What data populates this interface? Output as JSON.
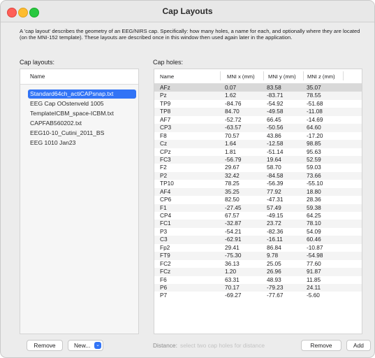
{
  "window": {
    "title": "Cap Layouts",
    "description": "A 'cap layout' describes the geometry of an EEG/NIRS cap. Specifically: how many holes, a name for each, and optionally where they are located (on the MNI-152 template). These layouts are described once in this window then used again later in the application."
  },
  "cap_layouts": {
    "label": "Cap layouts:",
    "column_header": "Name",
    "items": [
      {
        "label": "Standard64ch_actiCAPsnap.txt",
        "selected": true
      },
      {
        "label": "EEG Cap OOstenveld 1005",
        "selected": false
      },
      {
        "label": "TemplateICBM_space-ICBM.txt",
        "selected": false
      },
      {
        "label": "CAPFAB560202.txt",
        "selected": false
      },
      {
        "label": "EEG10-10_Cutini_2011_BS",
        "selected": false
      },
      {
        "label": "EEG 1010 Jan23",
        "selected": false
      }
    ],
    "remove_label": "Remove",
    "new_label": "New...",
    "new_dropdown_icon": "chevron-down-icon"
  },
  "cap_holes": {
    "label": "Cap holes:",
    "columns": [
      "Name",
      "MNI x (mm)",
      "MNI y (mm)",
      "MNI z (mm)"
    ],
    "rows": [
      [
        "AFz",
        "0.07",
        "83.58",
        "35.07"
      ],
      [
        "Pz",
        "1.62",
        "-83.71",
        "78.55"
      ],
      [
        "TP9",
        "-84.76",
        "-54.92",
        "-51.68"
      ],
      [
        "TP8",
        "84.70",
        "-49.58",
        "-11.08"
      ],
      [
        "AF7",
        "-52.72",
        "66.45",
        "-14.69"
      ],
      [
        "CP3",
        "-63.57",
        "-50.56",
        "64.60"
      ],
      [
        "F8",
        "70.57",
        "43.86",
        "-17.20"
      ],
      [
        "Cz",
        "1.64",
        "-12.58",
        "98.85"
      ],
      [
        "CPz",
        "1.81",
        "-51.14",
        "95.63"
      ],
      [
        "FC3",
        "-56.79",
        "19.64",
        "52.59"
      ],
      [
        "F2",
        "29.67",
        "58.70",
        "59.03"
      ],
      [
        "P2",
        "32.42",
        "-84.58",
        "73.66"
      ],
      [
        "TP10",
        "78.25",
        "-56.39",
        "-55.10"
      ],
      [
        "AF4",
        "35.25",
        "77.92",
        "18.80"
      ],
      [
        "CP6",
        "82.50",
        "-47.31",
        "28.36"
      ],
      [
        "F1",
        "-27.45",
        "57.49",
        "59.38"
      ],
      [
        "CP4",
        "67.57",
        "-49.15",
        "64.25"
      ],
      [
        "FC1",
        "-32.87",
        "23.72",
        "78.10"
      ],
      [
        "P3",
        "-54.21",
        "-82.36",
        "54.09"
      ],
      [
        "C3",
        "-62.91",
        "-16.11",
        "60.46"
      ],
      [
        "Fp2",
        "29.41",
        "86.84",
        "-10.87"
      ],
      [
        "FT9",
        "-75.30",
        "9.78",
        "-54.98"
      ],
      [
        "FC2",
        "36.13",
        "25.05",
        "77.60"
      ],
      [
        "FCz",
        "1.20",
        "26.96",
        "91.87"
      ],
      [
        "F6",
        "63.31",
        "48.93",
        "11.85"
      ],
      [
        "P6",
        "70.17",
        "-79.23",
        "24.11"
      ],
      [
        "P7",
        "-69.27",
        "-77.67",
        "-5.60"
      ]
    ],
    "selected_row": 0,
    "distance_label": "Distance:",
    "distance_value": "select two cap holes for distance",
    "remove_label": "Remove",
    "add_label": "Add"
  }
}
